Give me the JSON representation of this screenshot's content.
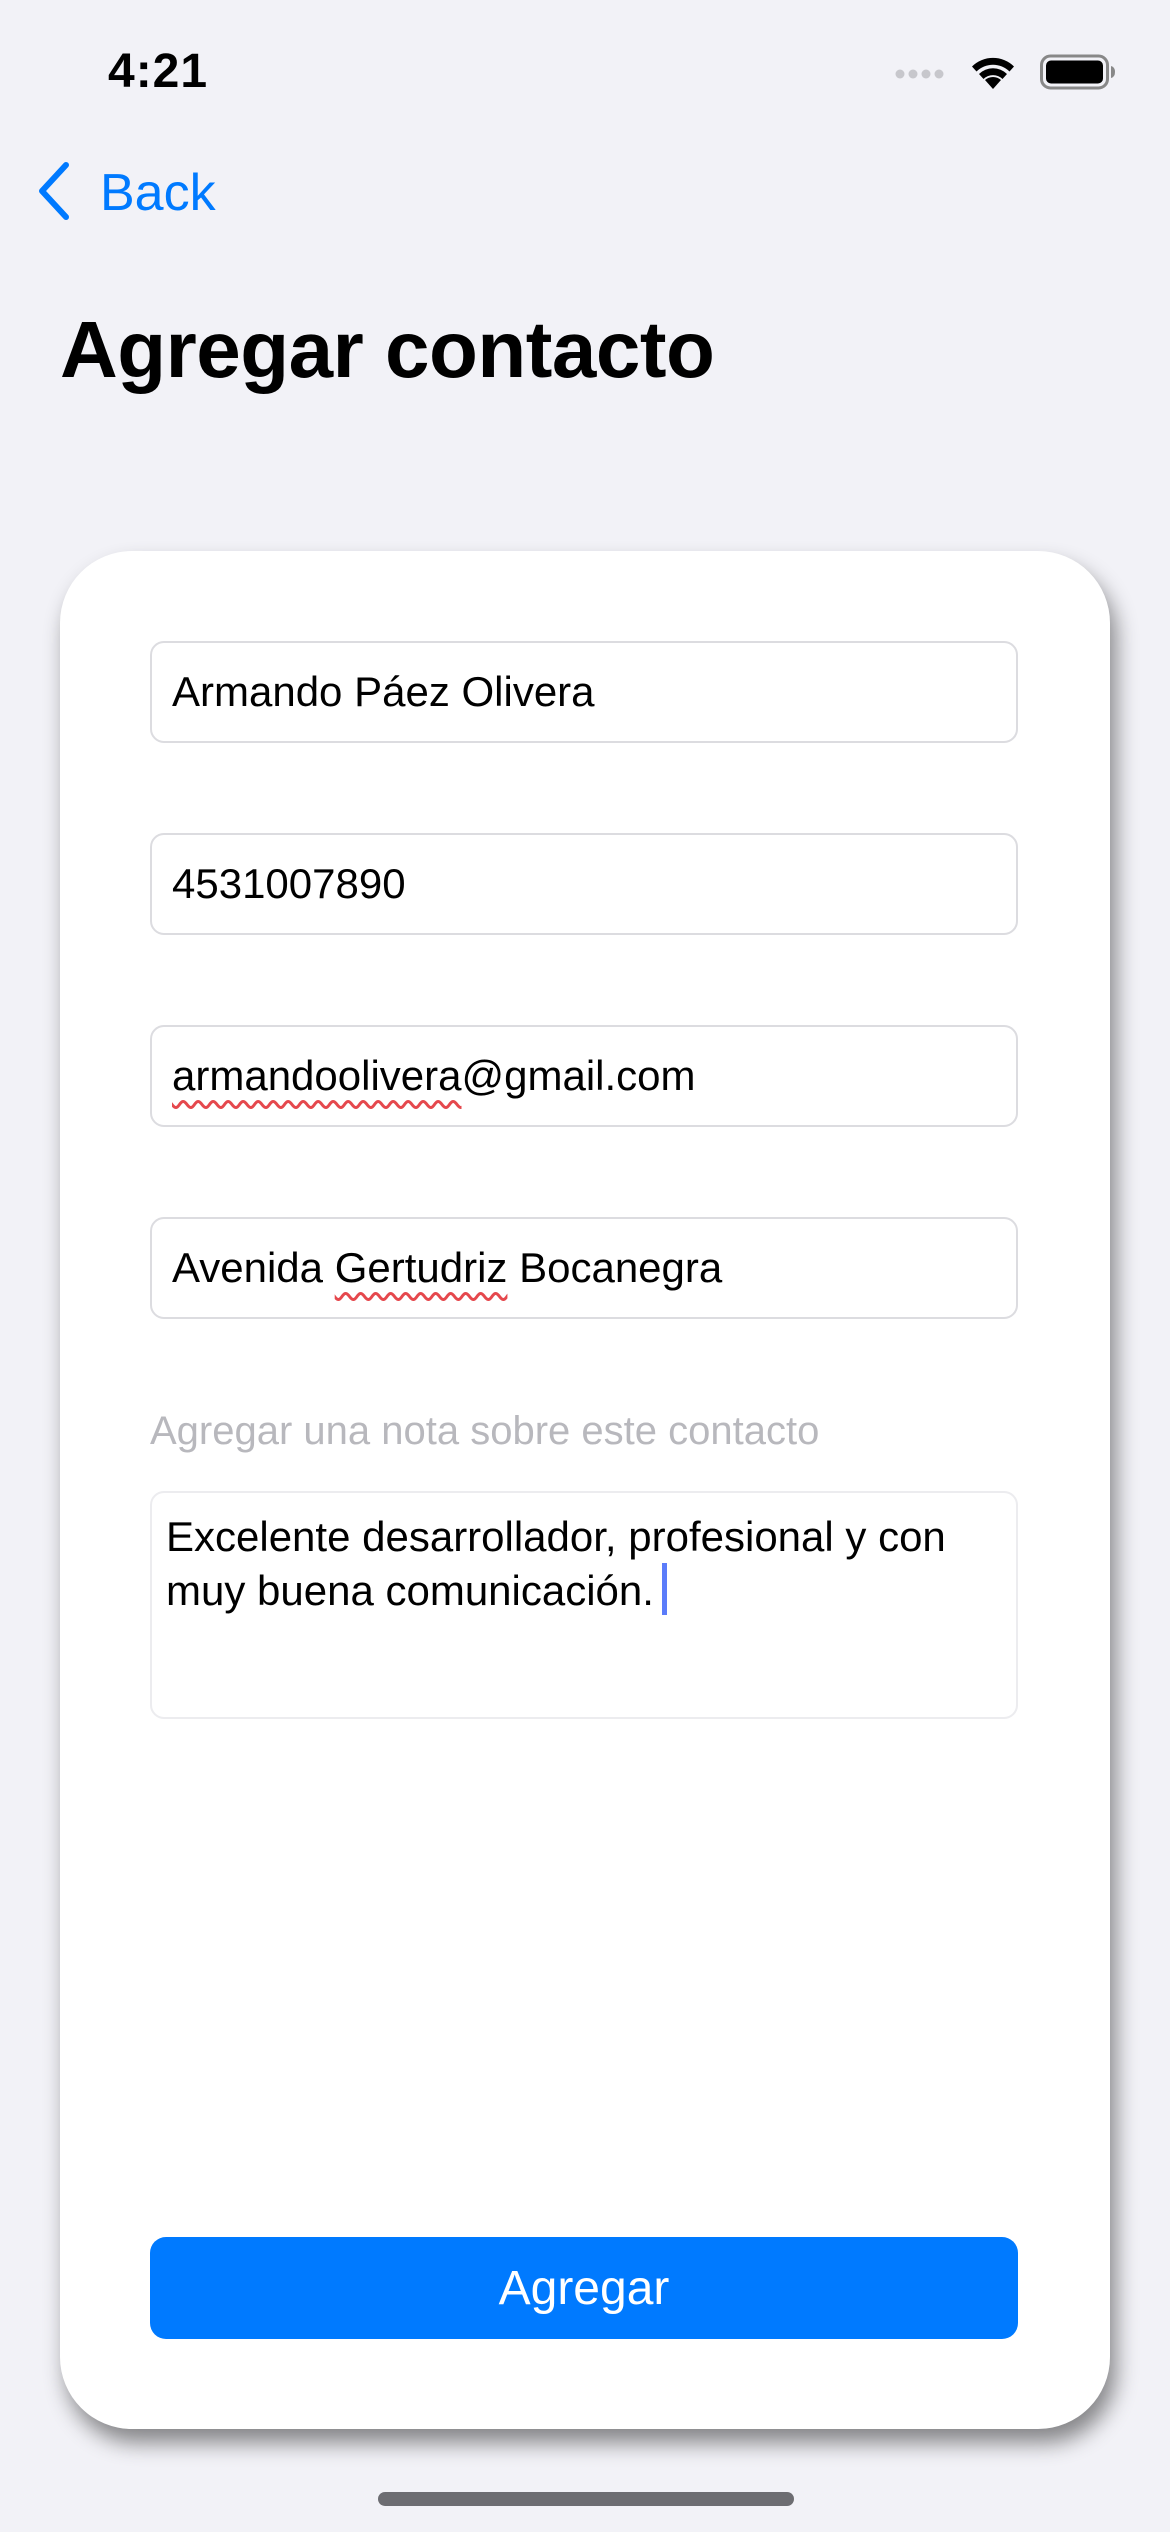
{
  "status_bar": {
    "time": "4:21",
    "icons": [
      "cellular-signal-icon",
      "wifi-icon",
      "battery-icon"
    ]
  },
  "nav": {
    "back_label": "Back",
    "back_icon": "chevron-left-icon"
  },
  "page": {
    "title": "Agregar contacto"
  },
  "form": {
    "name_value": "Armando Páez Olivera",
    "phone_value": "4531007890",
    "email_value_misspelled": "armandoolivera",
    "email_value_rest": "@gmail.com",
    "address_prefix": "Avenida ",
    "address_misspelled": "Gertudriz",
    "address_suffix": " Bocanegra",
    "note_label": "Agregar una nota sobre este contacto",
    "note_value": "Excelente desarrollador, profesional y con muy buena comunicación.",
    "submit_label": "Agregar"
  },
  "colors": {
    "accent": "#007aff",
    "background": "#f2f2f7",
    "card": "#ffffff",
    "placeholder": "#b8b8bd",
    "spellcheck": "#e5484d"
  }
}
